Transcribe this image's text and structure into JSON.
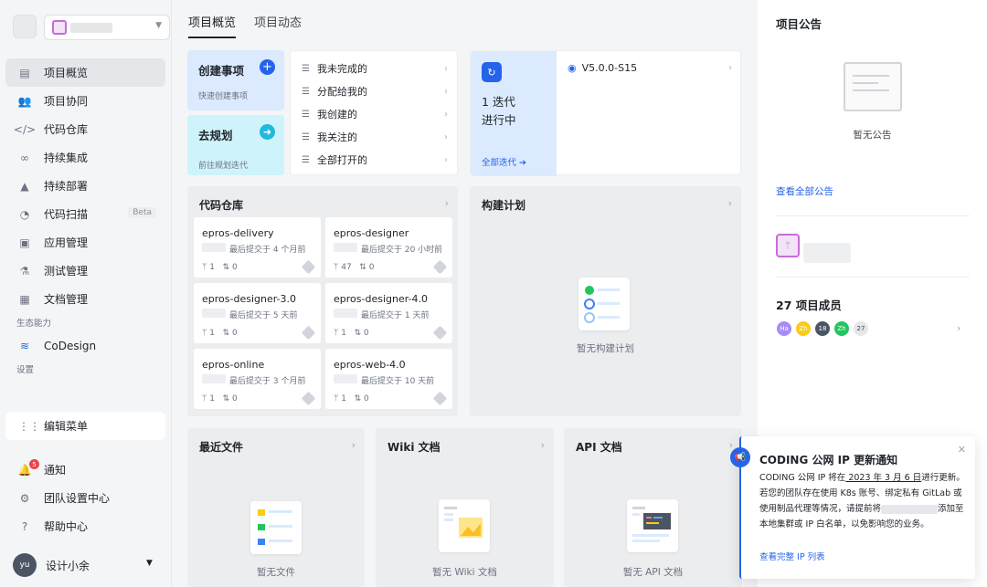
{
  "sidebar": {
    "nav": [
      {
        "label": "项目概览",
        "icon": "overview-icon"
      },
      {
        "label": "项目协同",
        "icon": "team-icon"
      },
      {
        "label": "代码仓库",
        "icon": "code-icon"
      },
      {
        "label": "持续集成",
        "icon": "infinity-icon"
      },
      {
        "label": "持续部署",
        "icon": "rocket-icon"
      },
      {
        "label": "代码扫描",
        "icon": "scan-icon",
        "badge": "Beta"
      },
      {
        "label": "应用管理",
        "icon": "box-icon"
      },
      {
        "label": "测试管理",
        "icon": "flask-icon"
      },
      {
        "label": "文档管理",
        "icon": "doc-icon"
      }
    ],
    "eco_label": "生态能力",
    "codesign": "CoDesign",
    "settings_label": "设置",
    "edit_menu": "编辑菜单",
    "bottom": [
      {
        "label": "通知",
        "badge": "5"
      },
      {
        "label": "团队设置中心"
      },
      {
        "label": "帮助中心"
      }
    ],
    "user": {
      "initials": "yu",
      "name": "设计小余"
    }
  },
  "tabs": [
    "项目概览",
    "项目动态"
  ],
  "quick": {
    "create_title": "创建事项",
    "create_sub": "快速创建事项",
    "plan_title": "去规划",
    "plan_sub": "前往规划迭代"
  },
  "filters": [
    "我未完成的",
    "分配给我的",
    "我创建的",
    "我关注的",
    "全部打开的"
  ],
  "iteration": {
    "count_line1": "1 迭代",
    "count_line2": "进行中",
    "all_link": "全部迭代",
    "version": "V5.0.0-S15"
  },
  "repos": {
    "title": "代码仓库",
    "items": [
      {
        "name": "epros-delivery",
        "commit": "最后提交于 4 个月前",
        "branches": "1",
        "mrs": "0"
      },
      {
        "name": "epros-designer",
        "commit": "最后提交于 20 小时前",
        "branches": "47",
        "mrs": "0"
      },
      {
        "name": "epros-designer-3.0",
        "commit": "最后提交于 5 天前",
        "branches": "1",
        "mrs": "0"
      },
      {
        "name": "epros-designer-4.0",
        "commit": "最后提交于 1 天前",
        "branches": "1",
        "mrs": "0"
      },
      {
        "name": "epros-online",
        "commit": "最后提交于 3 个月前",
        "branches": "1",
        "mrs": "0"
      },
      {
        "name": "epros-web-4.0",
        "commit": "最后提交于 10 天前",
        "branches": "1",
        "mrs": "0"
      }
    ]
  },
  "build": {
    "title": "构建计划",
    "empty": "暂无构建计划"
  },
  "recent": {
    "title": "最近文件",
    "empty": "暂无文件"
  },
  "wiki": {
    "title": "Wiki 文档",
    "empty": "暂无 Wiki 文档"
  },
  "api": {
    "title": "API 文档",
    "empty": "暂无 API 文档"
  },
  "right": {
    "notice_title": "项目公告",
    "no_notice": "暂无公告",
    "all_notice": "查看全部公告",
    "members_title": "27 项目成员",
    "members": [
      {
        "initials": "Ha",
        "color": "#a78bfa"
      },
      {
        "initials": "Zh",
        "color": "#facc15"
      },
      {
        "initials": "18",
        "color": "#4b5563"
      },
      {
        "initials": "Zh",
        "color": "#22c55e"
      },
      {
        "initials": "27",
        "color": "#e5e7eb"
      }
    ]
  },
  "toast": {
    "title": "CODING 公网 IP 更新通知",
    "p1": "CODING 公网 IP 将在",
    "date": " 2023 年 3 月 6 日",
    "p2": "进行更新。若您的团队存在使用 K8s 账号、绑定私有 GitLab 或使用制品代理等情况，请提前将",
    "p3": "添加至本地集群或 IP 白名单，以免影响您的业务。",
    "link": "查看完整 IP 列表"
  }
}
